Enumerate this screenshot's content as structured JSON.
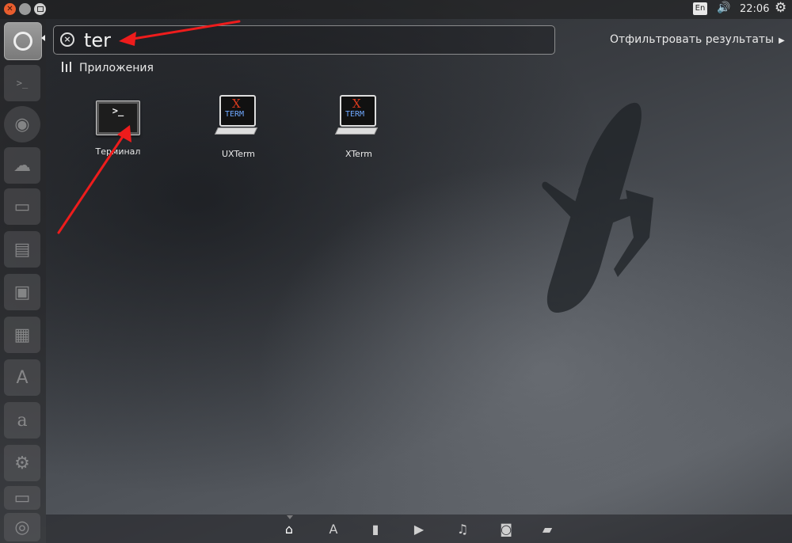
{
  "top_panel": {
    "language": "En",
    "clock": "22:06"
  },
  "search": {
    "query": "ter",
    "filter_label": "Отфильтровать результаты"
  },
  "category": {
    "label": "Приложения"
  },
  "apps": [
    {
      "label": "Терминал",
      "icon": "terminal-icon",
      "glyph": ">_"
    },
    {
      "label": "UXTerm",
      "icon": "uxterm-icon",
      "x": "X",
      "term": "TERM"
    },
    {
      "label": "XTerm",
      "icon": "xterm-icon",
      "x": "X",
      "term": "TERM"
    }
  ],
  "launcher": [
    "dash-home-icon",
    "terminal-icon",
    "firefox-icon",
    "cloud-icon",
    "files-icon",
    "writer-icon",
    "impress-icon",
    "calc-icon",
    "software-center-icon",
    "amazon-icon",
    "settings-icon",
    "removable-drive-icon",
    "trash-icon"
  ],
  "lenses": [
    "home-icon",
    "applications-icon",
    "files-icon",
    "video-icon",
    "music-icon",
    "photos-icon",
    "social-icon"
  ],
  "colors": {
    "annotation_arrow": "#ee1c1c",
    "close_button": "#e85d2e"
  }
}
